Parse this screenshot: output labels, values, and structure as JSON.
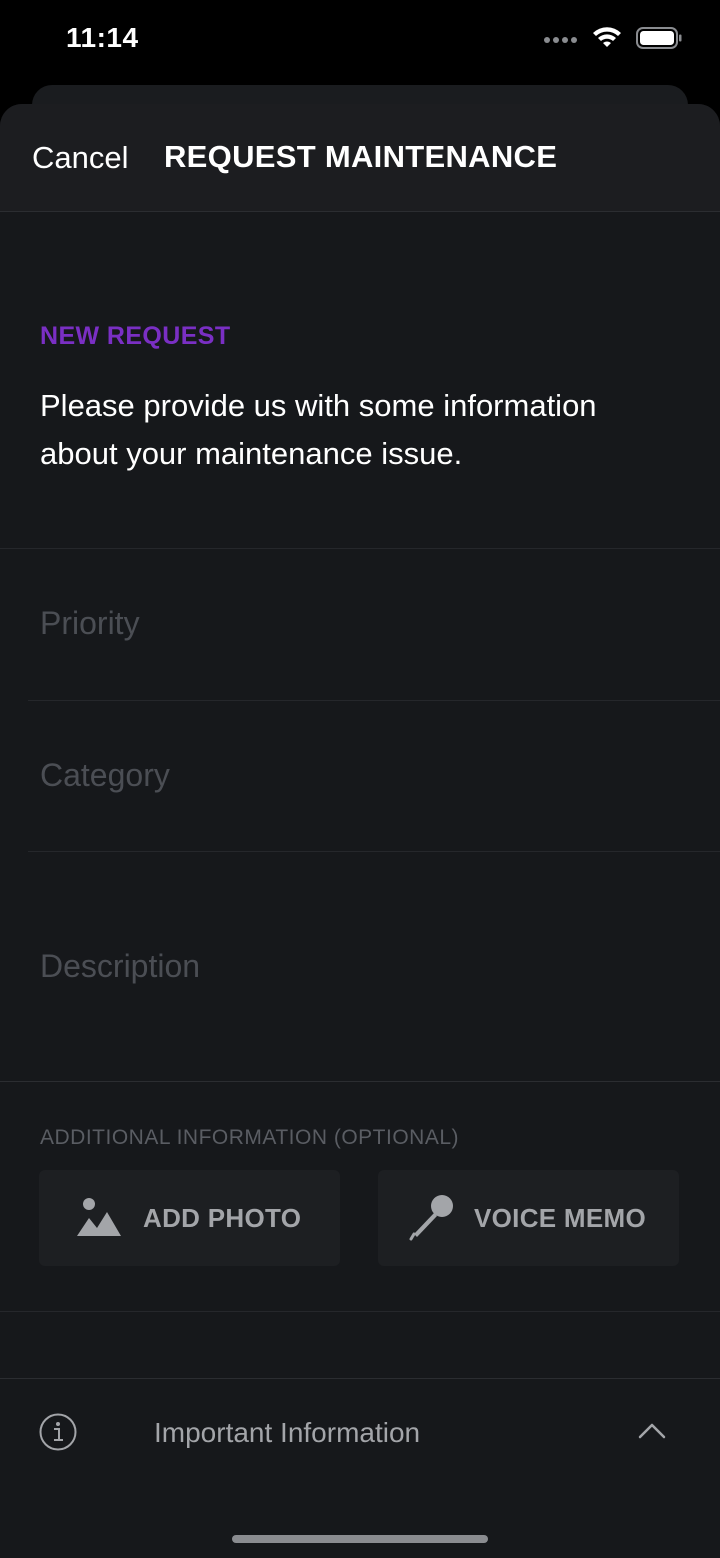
{
  "status_bar": {
    "time": "11:14",
    "icons": [
      "signal-dots-icon",
      "wifi-icon",
      "battery-icon"
    ]
  },
  "nav": {
    "cancel_label": "Cancel",
    "title": "REQUEST MAINTENANCE"
  },
  "intro": {
    "eyebrow": "NEW REQUEST",
    "text": "Please provide us with some information about your maintenance issue."
  },
  "form": {
    "priority_placeholder": "Priority",
    "category_placeholder": "Category",
    "description_placeholder": "Description"
  },
  "additional": {
    "title": "ADDITIONAL INFORMATION (OPTIONAL)",
    "add_photo_label": "ADD PHOTO",
    "voice_memo_label": "VOICE MEMO"
  },
  "info_bar": {
    "label": "Important Information"
  },
  "colors": {
    "accent": "#7a2fc4",
    "background": "#16181b",
    "nav_background": "#1c1d20",
    "placeholder": "#4b4e54",
    "button_background": "#1d1f22"
  }
}
